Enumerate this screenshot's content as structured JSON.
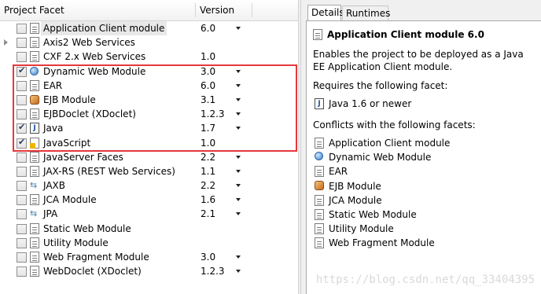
{
  "table": {
    "headers": {
      "facet": "Project Facet",
      "version": "Version"
    },
    "rows": [
      {
        "label": "Application Client module",
        "version": "6.0",
        "checked": false,
        "icon": "doc-icon",
        "dropdown": true,
        "selected": true,
        "expander": false
      },
      {
        "label": "Axis2 Web Services",
        "version": "",
        "checked": false,
        "icon": "doc-icon",
        "dropdown": false,
        "expander": true
      },
      {
        "label": "CXF 2.x Web Services",
        "version": "1.0",
        "checked": false,
        "icon": "doc-icon",
        "dropdown": false
      },
      {
        "label": "Dynamic Web Module",
        "version": "3.0",
        "checked": true,
        "icon": "globe-icon",
        "dropdown": true
      },
      {
        "label": "EAR",
        "version": "6.0",
        "checked": false,
        "icon": "doc-icon",
        "dropdown": true
      },
      {
        "label": "EJB Module",
        "version": "3.1",
        "checked": false,
        "icon": "ejb-icon",
        "dropdown": true
      },
      {
        "label": "EJBDoclet (XDoclet)",
        "version": "1.2.3",
        "checked": false,
        "icon": "doc-icon",
        "dropdown": true
      },
      {
        "label": "Java",
        "version": "1.7",
        "checked": true,
        "icon": "java-icon",
        "dropdown": true
      },
      {
        "label": "JavaScript",
        "version": "1.0",
        "checked": true,
        "icon": "javascript-icon",
        "dropdown": false
      },
      {
        "label": "JavaServer Faces",
        "version": "2.2",
        "checked": false,
        "icon": "doc-icon",
        "dropdown": true
      },
      {
        "label": "JAX-RS (REST Web Services)",
        "version": "1.1",
        "checked": false,
        "icon": "doc-icon",
        "dropdown": true
      },
      {
        "label": "JAXB",
        "version": "2.2",
        "checked": false,
        "icon": "arrows-icon",
        "dropdown": true
      },
      {
        "label": "JCA Module",
        "version": "1.6",
        "checked": false,
        "icon": "doc-icon",
        "dropdown": true
      },
      {
        "label": "JPA",
        "version": "2.1",
        "checked": false,
        "icon": "arrows-icon",
        "dropdown": true
      },
      {
        "label": "Static Web Module",
        "version": "",
        "checked": false,
        "icon": "doc-icon",
        "dropdown": false
      },
      {
        "label": "Utility Module",
        "version": "",
        "checked": false,
        "icon": "doc-icon",
        "dropdown": false
      },
      {
        "label": "Web Fragment Module",
        "version": "3.0",
        "checked": false,
        "icon": "doc-icon",
        "dropdown": true
      },
      {
        "label": "WebDoclet (XDoclet)",
        "version": "1.2.3",
        "checked": false,
        "icon": "doc-icon",
        "dropdown": true
      }
    ]
  },
  "details": {
    "tabs": {
      "details": "Details",
      "runtimes": "Runtimes"
    },
    "title": "Application Client module 6.0",
    "description": "Enables the project to be deployed as a Java EE Application Client module.",
    "requires_label": "Requires the following facet:",
    "requires": [
      {
        "label": "Java 1.6 or newer",
        "icon": "java-icon"
      }
    ],
    "conflicts_label": "Conflicts with the following facets:",
    "conflicts": [
      {
        "label": "Application Client module",
        "icon": "doc-icon"
      },
      {
        "label": "Dynamic Web Module",
        "icon": "globe-icon"
      },
      {
        "label": "EAR",
        "icon": "doc-icon"
      },
      {
        "label": "EJB Module",
        "icon": "ejb-icon"
      },
      {
        "label": "JCA Module",
        "icon": "doc-icon"
      },
      {
        "label": "Static Web Module",
        "icon": "doc-icon"
      },
      {
        "label": "Utility Module",
        "icon": "doc-icon"
      },
      {
        "label": "Web Fragment Module",
        "icon": "doc-icon"
      }
    ]
  },
  "watermark": "https://blog.csdn.net/qq_33404395",
  "colors": {
    "highlight_box": "#e5383b",
    "selection": "#e8e8e8"
  }
}
